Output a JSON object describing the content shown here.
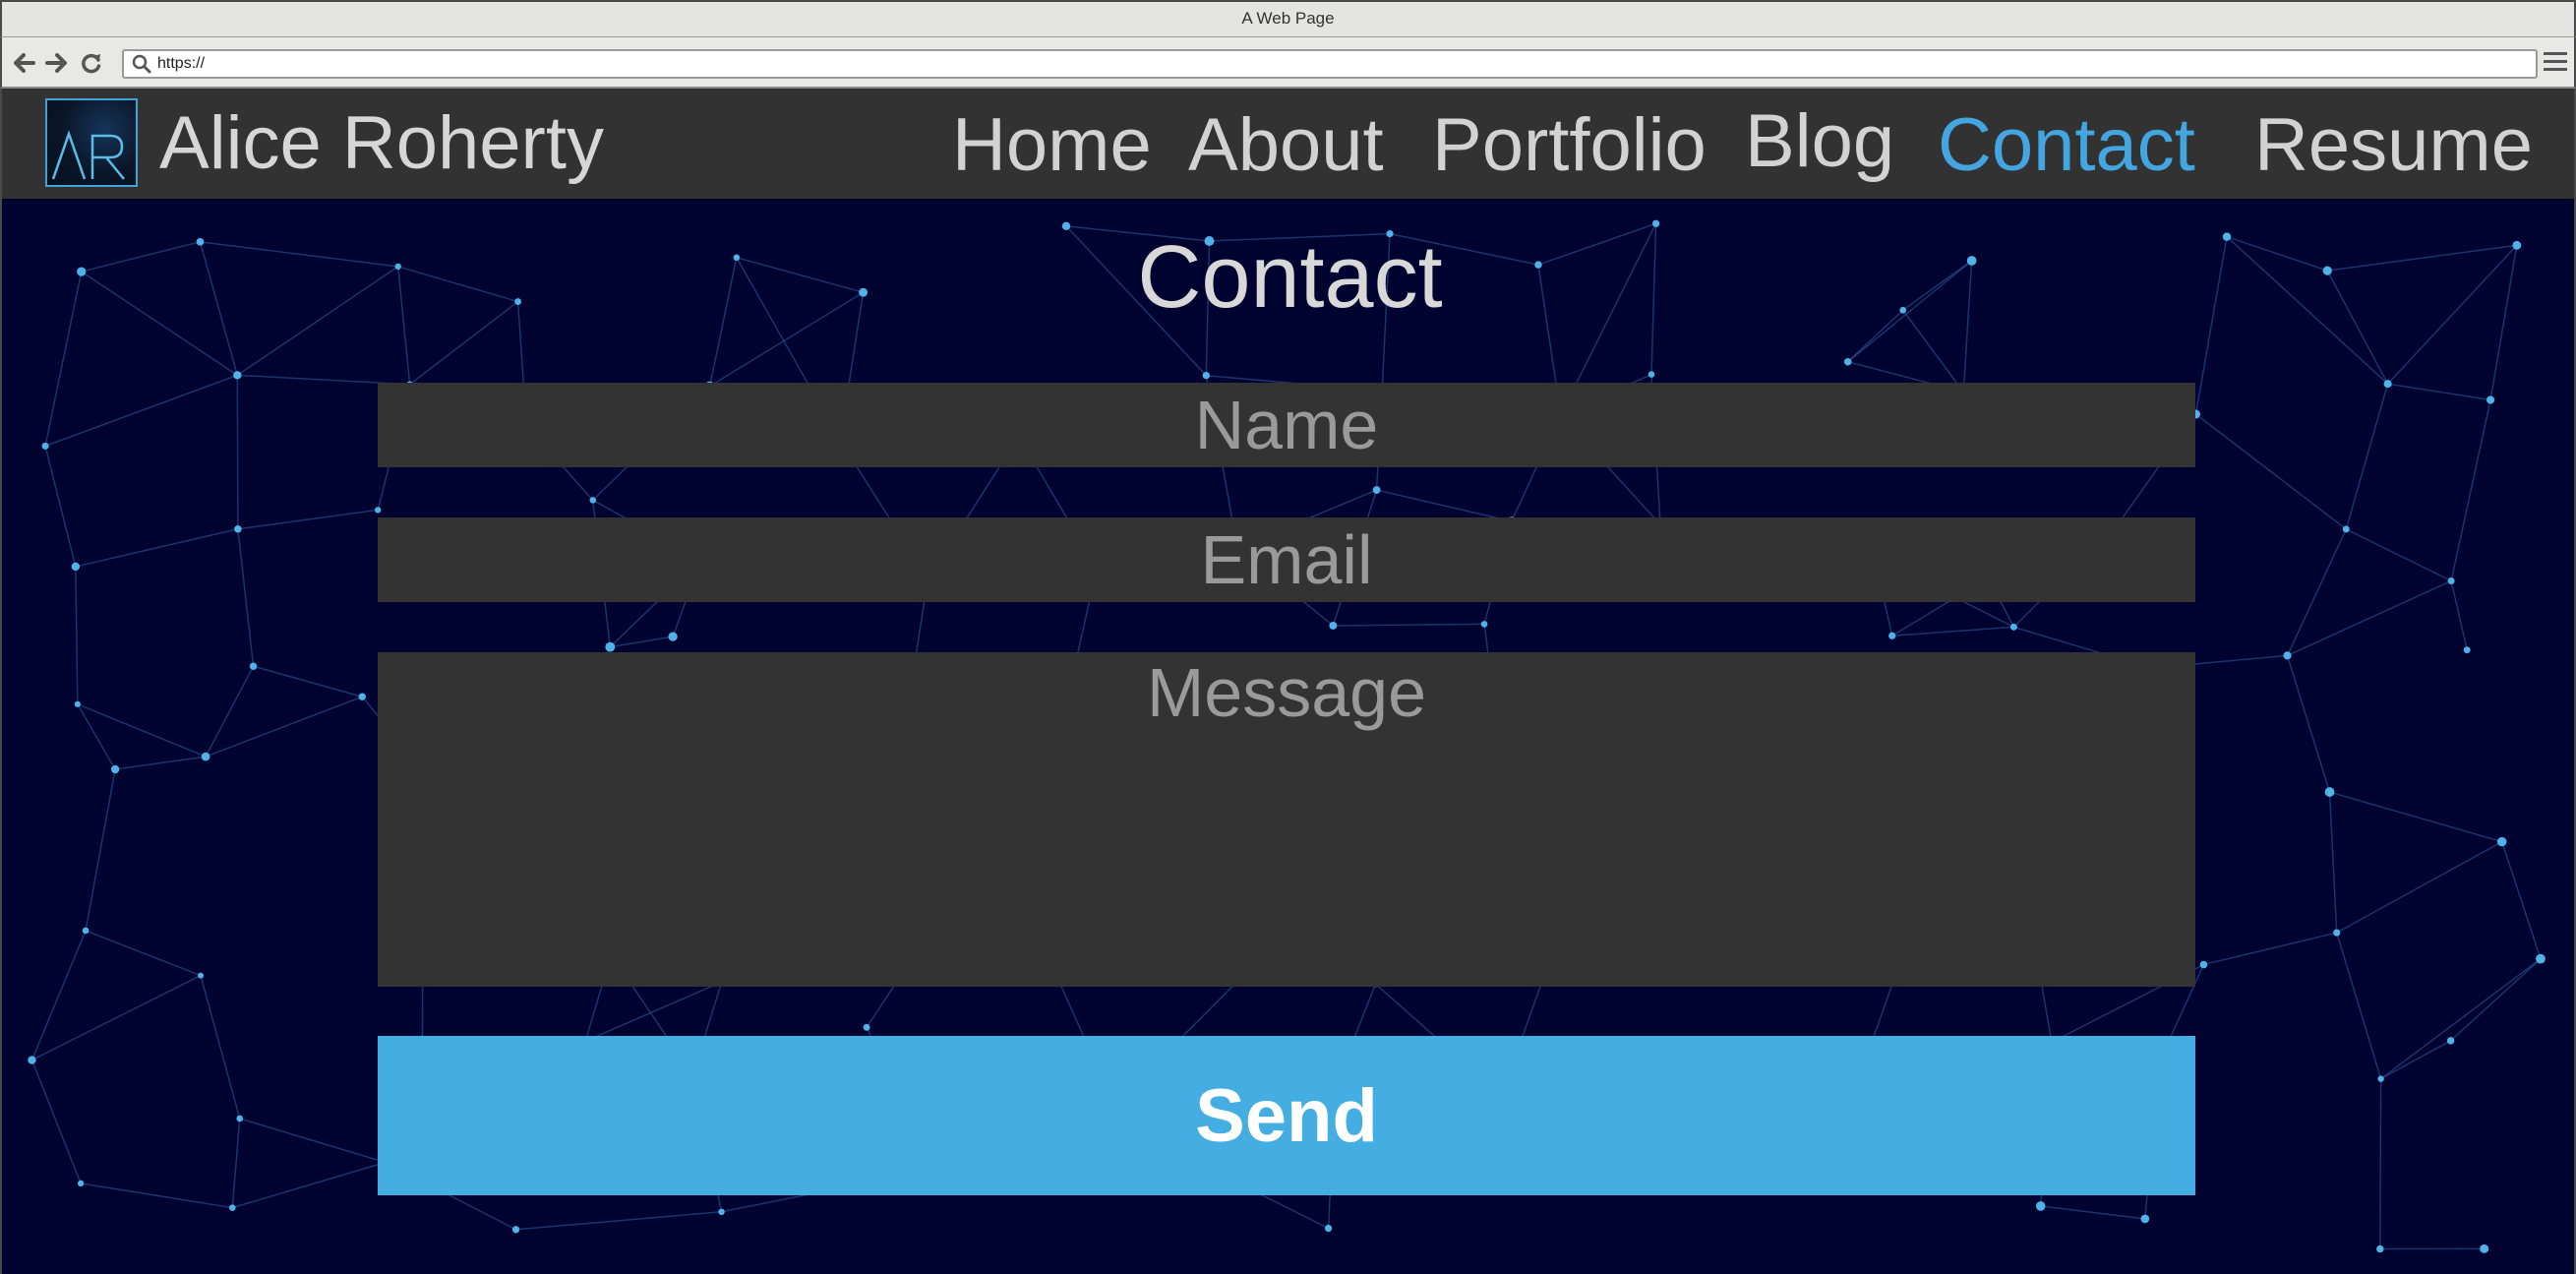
{
  "browser": {
    "window_title": "A Web Page",
    "url": "https://"
  },
  "site": {
    "logo_text": "AR",
    "name": "Alice Roherty",
    "nav": [
      {
        "label": "Home",
        "active": false
      },
      {
        "label": "About",
        "active": false
      },
      {
        "label": "Portfolio",
        "active": false
      },
      {
        "label": "Blog",
        "active": false
      },
      {
        "label": "Contact",
        "active": true
      },
      {
        "label": "Resume",
        "active": false
      }
    ]
  },
  "contact": {
    "title": "Contact",
    "name_placeholder": "Name",
    "email_placeholder": "Email",
    "message_placeholder": "Message",
    "send_label": "Send"
  },
  "colors": {
    "accent": "#44a6e0",
    "header_bg": "#323232",
    "page_bg": "#000230",
    "field_bg": "#333333",
    "button_bg": "#44ade2"
  }
}
